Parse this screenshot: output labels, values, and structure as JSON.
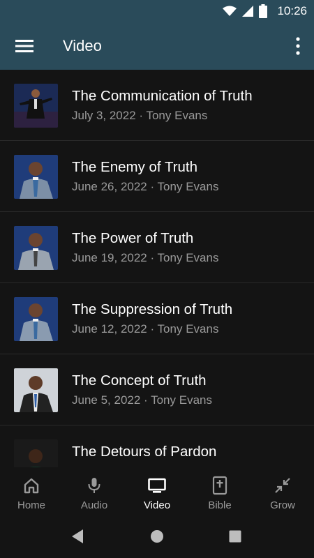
{
  "status_bar": {
    "time": "10:26"
  },
  "app_bar": {
    "title": "Video"
  },
  "videos": [
    {
      "title": "The Communication of Truth",
      "subtitle": "July 3, 2022 · Tony Evans"
    },
    {
      "title": "The Enemy of Truth",
      "subtitle": "June 26, 2022 · Tony Evans"
    },
    {
      "title": "The Power of Truth",
      "subtitle": "June 19, 2022 · Tony Evans"
    },
    {
      "title": "The Suppression of Truth",
      "subtitle": "June 12, 2022 · Tony Evans"
    },
    {
      "title": "The Concept of Truth",
      "subtitle": "June 5, 2022 · Tony Evans"
    },
    {
      "title": "The Detours of Pardon",
      "subtitle": ""
    }
  ],
  "bottom_nav": [
    {
      "label": "Home",
      "icon": "home-icon"
    },
    {
      "label": "Audio",
      "icon": "microphone-icon"
    },
    {
      "label": "Video",
      "icon": "tv-icon",
      "active": true
    },
    {
      "label": "Bible",
      "icon": "bible-icon"
    },
    {
      "label": "Grow",
      "icon": "grow-icon"
    }
  ],
  "colors": {
    "accent": "#2a4b5a",
    "background": "#141414",
    "muted": "#9a9a9a"
  }
}
